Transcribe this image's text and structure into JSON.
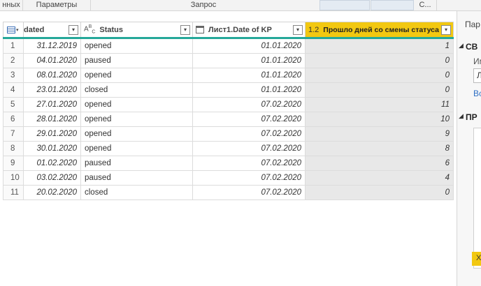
{
  "ribbon": {
    "groups": [
      "нных",
      "Параметры",
      "Запрос",
      "С..."
    ]
  },
  "right_pane": {
    "title": "Пар",
    "section1": "СВ",
    "label1": "Им",
    "input_value": "Л",
    "link": "Вс",
    "section2": "ПР",
    "step_mark": "Х"
  },
  "columns": [
    {
      "label": "dated",
      "type_icon": "calendar-icon"
    },
    {
      "label": "Status",
      "type_icon": "ABC"
    },
    {
      "label": "Лист1.Date of KP",
      "type_icon": "calendar-icon"
    },
    {
      "label": "Прошло дней со смены статуса",
      "type_icon": "1.2"
    }
  ],
  "rows": [
    {
      "i": "1",
      "d": "31.12.2019",
      "s": "opened",
      "kp": "01.01.2020",
      "n": "1"
    },
    {
      "i": "2",
      "d": "04.01.2020",
      "s": "paused",
      "kp": "01.01.2020",
      "n": "0"
    },
    {
      "i": "3",
      "d": "08.01.2020",
      "s": "opened",
      "kp": "01.01.2020",
      "n": "0"
    },
    {
      "i": "4",
      "d": "23.01.2020",
      "s": "closed",
      "kp": "01.01.2020",
      "n": "0"
    },
    {
      "i": "5",
      "d": "27.01.2020",
      "s": "opened",
      "kp": "07.02.2020",
      "n": "11"
    },
    {
      "i": "6",
      "d": "28.01.2020",
      "s": "opened",
      "kp": "07.02.2020",
      "n": "10"
    },
    {
      "i": "7",
      "d": "29.01.2020",
      "s": "opened",
      "kp": "07.02.2020",
      "n": "9"
    },
    {
      "i": "8",
      "d": "30.01.2020",
      "s": "opened",
      "kp": "07.02.2020",
      "n": "8"
    },
    {
      "i": "9",
      "d": "01.02.2020",
      "s": "paused",
      "kp": "07.02.2020",
      "n": "6"
    },
    {
      "i": "10",
      "d": "03.02.2020",
      "s": "paused",
      "kp": "07.02.2020",
      "n": "4"
    },
    {
      "i": "11",
      "d": "20.02.2020",
      "s": "closed",
      "kp": "07.02.2020",
      "n": "0"
    }
  ],
  "colors": {
    "accent": "#f2c811",
    "quality_bar": "#25a89a",
    "link": "#2e6fc4"
  }
}
